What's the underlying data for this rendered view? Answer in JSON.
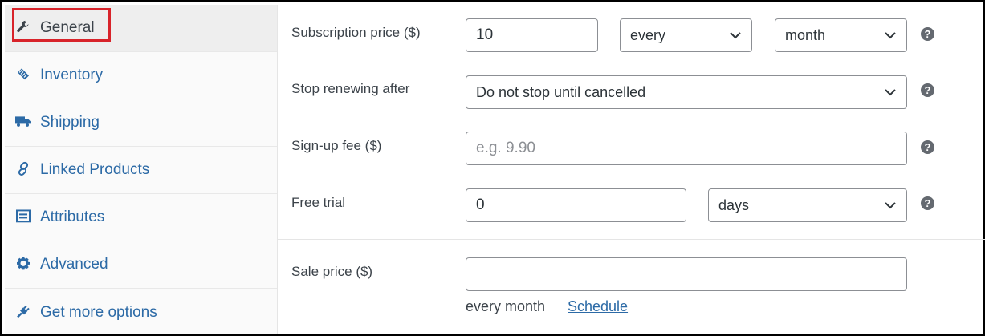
{
  "tabs": [
    {
      "label": "General",
      "icon": "wrench-icon",
      "active": true
    },
    {
      "label": "Inventory",
      "icon": "tag-icon"
    },
    {
      "label": "Shipping",
      "icon": "truck-icon"
    },
    {
      "label": "Linked Products",
      "icon": "link-icon"
    },
    {
      "label": "Attributes",
      "icon": "list-icon"
    },
    {
      "label": "Advanced",
      "icon": "gear-icon"
    },
    {
      "label": "Get more options",
      "icon": "plug-icon"
    }
  ],
  "fields": {
    "subscription_price": {
      "label": "Subscription price ($)",
      "value": "10",
      "interval": "every",
      "period": "month"
    },
    "stop_renewing": {
      "label": "Stop renewing after",
      "value": "Do not stop until cancelled"
    },
    "signup_fee": {
      "label": "Sign-up fee ($)",
      "placeholder": "e.g. 9.90"
    },
    "free_trial": {
      "label": "Free trial",
      "value": "0",
      "period": "days"
    },
    "sale_price": {
      "label": "Sale price ($)",
      "value": "",
      "suffix": "every month",
      "schedule_link": "Schedule"
    }
  },
  "help_glyph": "?",
  "colors": {
    "link": "#2c6aa6",
    "highlight": "#d8232a"
  }
}
